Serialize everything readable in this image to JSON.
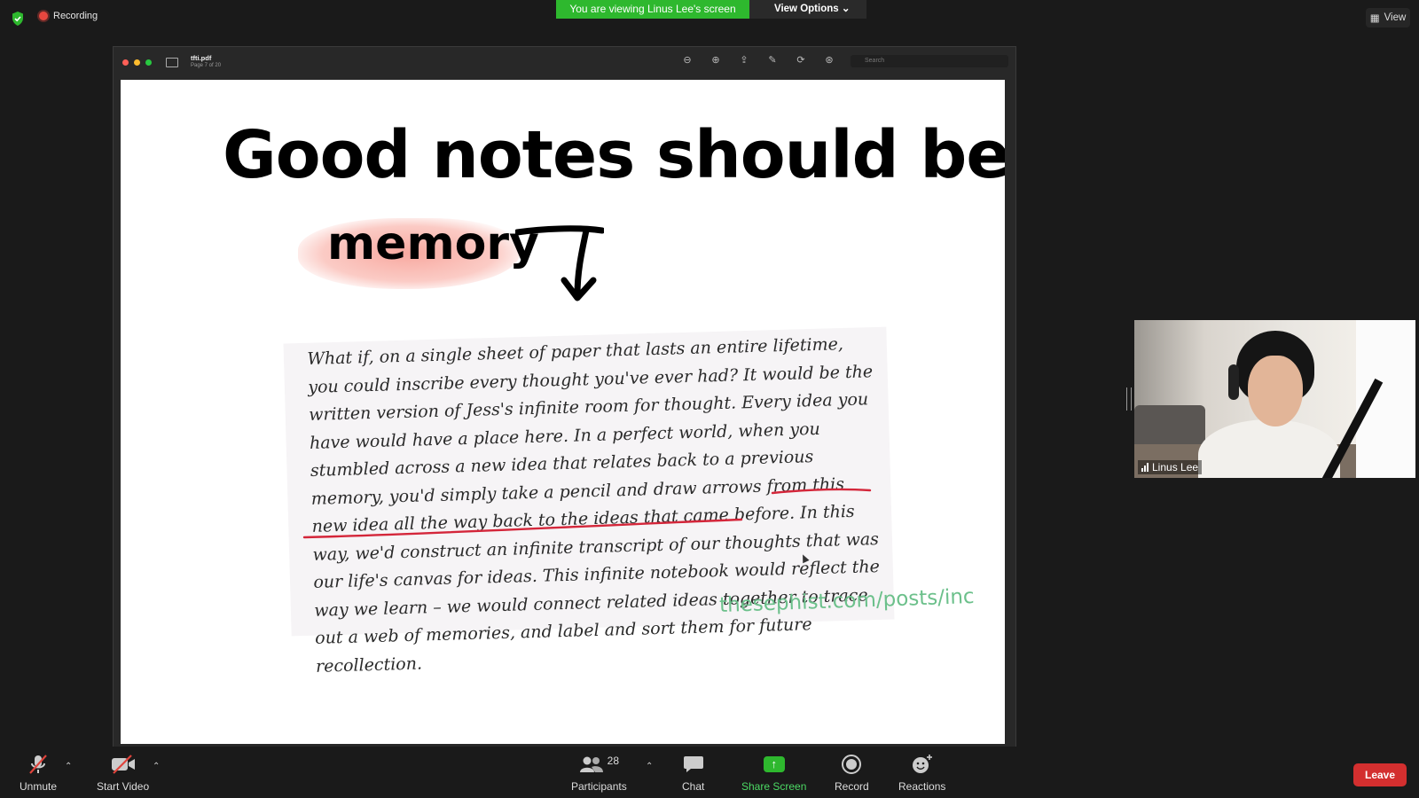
{
  "top": {
    "recording_label": "Recording",
    "banner_text": "You are viewing Linus Lee's screen",
    "view_options_label": "View Options",
    "view_label": "View"
  },
  "pdf": {
    "file_name": "tfti.pdf",
    "page_info": "Page 7 of 20",
    "search_placeholder": "Search"
  },
  "slide": {
    "title": "Good notes should behave like",
    "highlight_word": "memory",
    "quote": "What if, on a single sheet of paper that lasts an entire lifetime, you could inscribe every thought you've ever had? It would be the written version of Jess's infinite room for thought. Every idea you have would have a place here. In a perfect world, when you stumbled across a new idea that relates back to a previous memory, you'd simply take a pencil and draw arrows from this new idea all the way back to the ideas that came before. In this way, we'd construct an infinite transcript of our thoughts that was our life's canvas for ideas. This infinite notebook would reflect the way we learn – we would connect related ideas together to trace out a web of memories, and label and sort them for future recollection.",
    "credit": "thesephist.com/posts/inc",
    "highlight_color": "#f8a9a0",
    "underline_color": "#d4263a",
    "credit_color": "#6cc08b"
  },
  "video": {
    "participant_name": "Linus Lee"
  },
  "controls": {
    "unmute": "Unmute",
    "start_video": "Start Video",
    "participants": "Participants",
    "participant_count": "28",
    "chat": "Chat",
    "share_screen": "Share Screen",
    "record": "Record",
    "reactions": "Reactions",
    "leave": "Leave"
  },
  "colors": {
    "banner_green": "#2eb82e",
    "leave_red": "#d32f2f",
    "background": "#1a1a1a"
  }
}
